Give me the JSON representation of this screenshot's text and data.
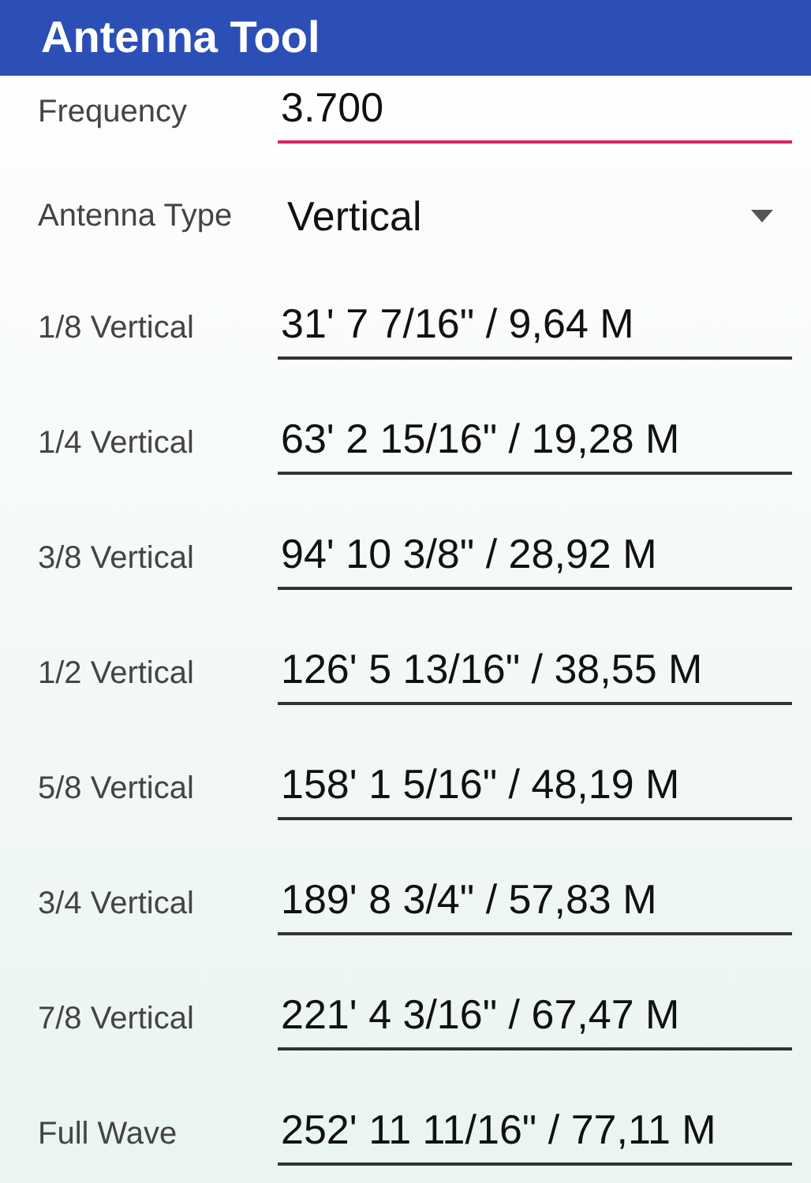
{
  "app_bar": {
    "title": "Antenna Tool"
  },
  "frequency": {
    "label": "Frequency",
    "value": "3.700",
    "focused": true
  },
  "antenna_type": {
    "label": "Antenna Type",
    "value": "Vertical"
  },
  "results": [
    {
      "label": "1/8 Vertical",
      "value": "31' 7 7/16\" / 9,64 M"
    },
    {
      "label": "1/4 Vertical",
      "value": "63' 2 15/16\" / 19,28 M"
    },
    {
      "label": "3/8 Vertical",
      "value": "94' 10 3/8\" / 28,92 M"
    },
    {
      "label": "1/2 Vertical",
      "value": "126' 5 13/16\" / 38,55 M"
    },
    {
      "label": "5/8 Vertical",
      "value": "158' 1 5/16\" / 48,19 M"
    },
    {
      "label": "3/4 Vertical",
      "value": "189' 8 3/4\" / 57,83 M"
    },
    {
      "label": "7/8 Vertical",
      "value": "221' 4 3/16\" / 67,47 M"
    },
    {
      "label": "Full Wave",
      "value": "252' 11 11/16\" / 77,11 M"
    }
  ]
}
